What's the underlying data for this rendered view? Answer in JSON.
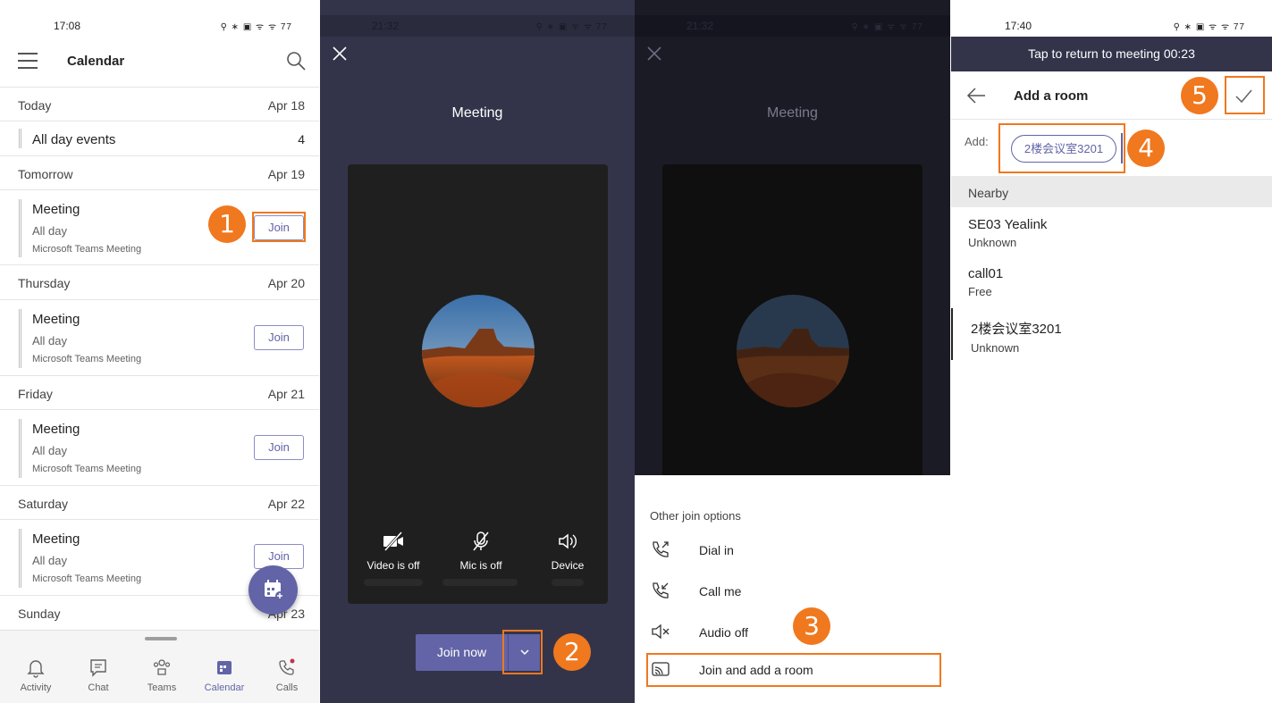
{
  "calendar_screen": {
    "status_time": "17:08",
    "status_icons": "⚲ ∗ ▣ ᯤ ᯤ 77",
    "title": "Calendar",
    "days": [
      {
        "label": "Today",
        "date": "Apr 18"
      },
      {
        "label": "Tomorrow",
        "date": "Apr 19"
      },
      {
        "label": "Thursday",
        "date": "Apr 20"
      },
      {
        "label": "Friday",
        "date": "Apr 21"
      },
      {
        "label": "Saturday",
        "date": "Apr 22"
      },
      {
        "label": "Sunday",
        "date": "Apr 23"
      }
    ],
    "all_day_events": {
      "label": "All day events",
      "count": "4"
    },
    "event": {
      "title": "Meeting",
      "time": "All day",
      "type": "Microsoft Teams Meeting",
      "join_label": "Join"
    },
    "nav": [
      {
        "label": "Activity",
        "icon": "bell-icon"
      },
      {
        "label": "Chat",
        "icon": "chat-icon"
      },
      {
        "label": "Teams",
        "icon": "teams-icon"
      },
      {
        "label": "Calendar",
        "icon": "calendar-icon"
      },
      {
        "label": "Calls",
        "icon": "phone-icon"
      }
    ]
  },
  "prejoin_screen": {
    "status_time": "21:32",
    "meeting_title": "Meeting",
    "video_label": "Video is off",
    "mic_label": "Mic is off",
    "device_label": "Device",
    "join_now": "Join now"
  },
  "options_screen": {
    "meeting_title": "Meeting",
    "sheet_title": "Other join options",
    "options": [
      {
        "label": "Dial in",
        "icon": "dial-in-icon"
      },
      {
        "label": "Call me",
        "icon": "call-me-icon"
      },
      {
        "label": "Audio off",
        "icon": "speaker-muted-icon"
      },
      {
        "label": "Join and add a room",
        "icon": "cast-icon"
      }
    ]
  },
  "add_room_screen": {
    "status_time": "17:40",
    "banner": "Tap to return to meeting 00:23",
    "title": "Add a room",
    "add_label": "Add:",
    "chip": "2楼会议室3201",
    "nearby_header": "Nearby",
    "rooms": [
      {
        "name": "SE03 Yealink",
        "status": "Unknown"
      },
      {
        "name": "call01",
        "status": "Free"
      },
      {
        "name": "2楼会议室3201",
        "status": "Unknown"
      }
    ]
  },
  "callouts": [
    "1",
    "2",
    "3",
    "4",
    "5"
  ],
  "colors": {
    "accent": "#6264a7",
    "callout": "#f0781e",
    "dark_bg": "#33344a"
  }
}
